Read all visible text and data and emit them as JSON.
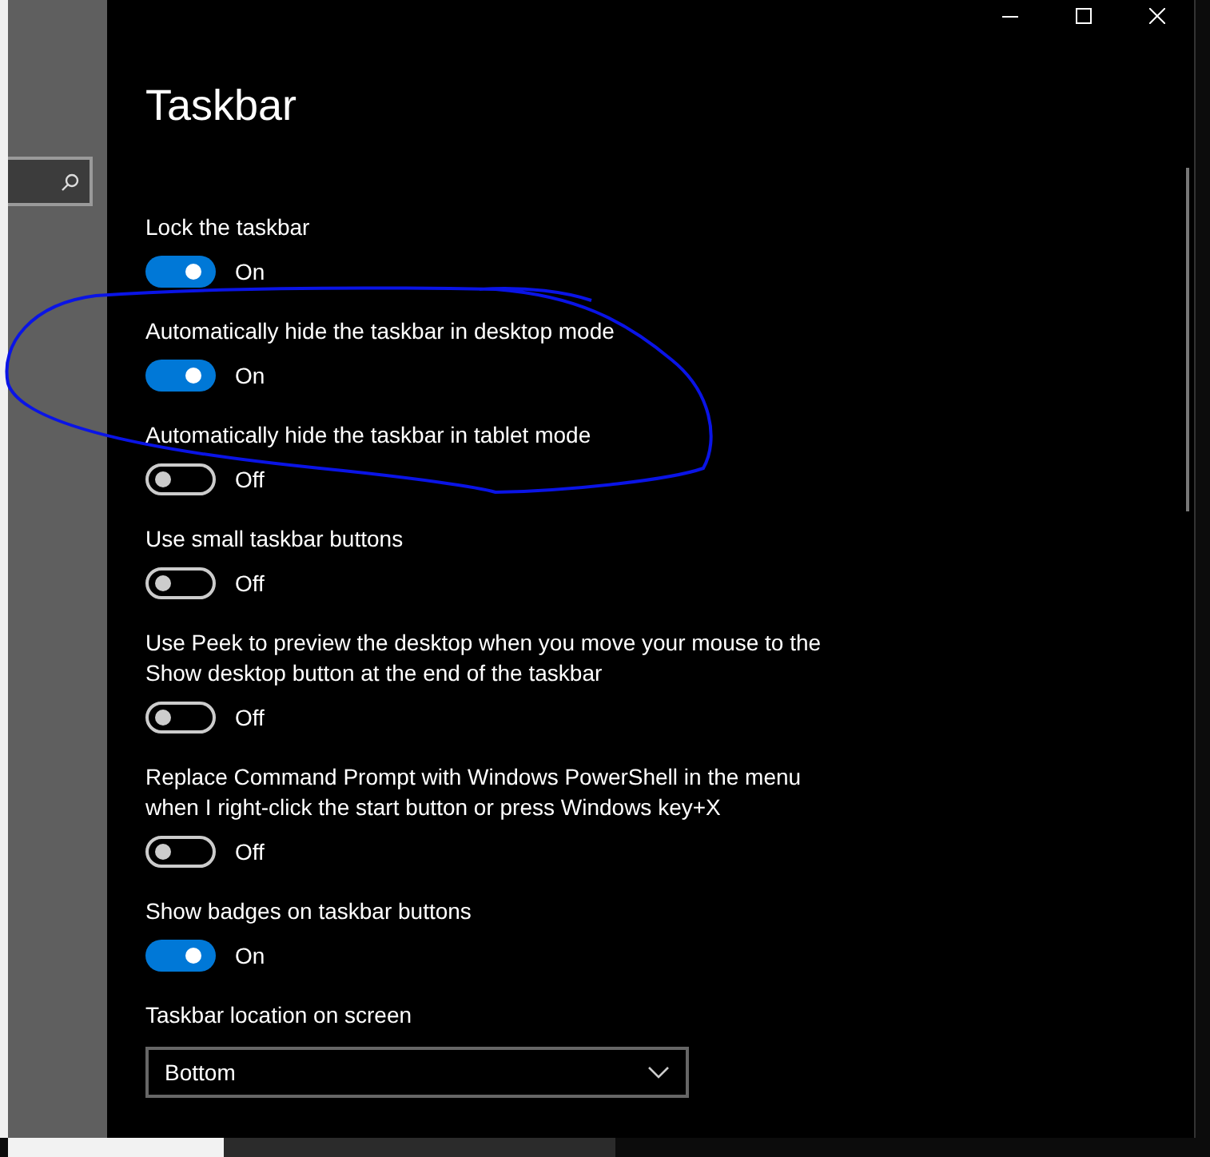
{
  "window": {
    "title": "Taskbar"
  },
  "settings": [
    {
      "label": "Lock the taskbar",
      "on": true,
      "state_text": "On"
    },
    {
      "label": "Automatically hide the taskbar in desktop mode",
      "on": true,
      "state_text": "On"
    },
    {
      "label": "Automatically hide the taskbar in tablet mode",
      "on": false,
      "state_text": "Off"
    },
    {
      "label": "Use small taskbar buttons",
      "on": false,
      "state_text": "Off"
    },
    {
      "label": "Use Peek to preview the desktop when you move your mouse to the Show desktop button at the end of the taskbar",
      "on": false,
      "state_text": "Off"
    },
    {
      "label": "Replace Command Prompt with Windows PowerShell in the menu when I right-click the start button or press Windows key+X",
      "on": false,
      "state_text": "Off"
    },
    {
      "label": "Show badges on taskbar buttons",
      "on": true,
      "state_text": "On"
    }
  ],
  "location": {
    "label": "Taskbar location on screen",
    "value": "Bottom"
  }
}
